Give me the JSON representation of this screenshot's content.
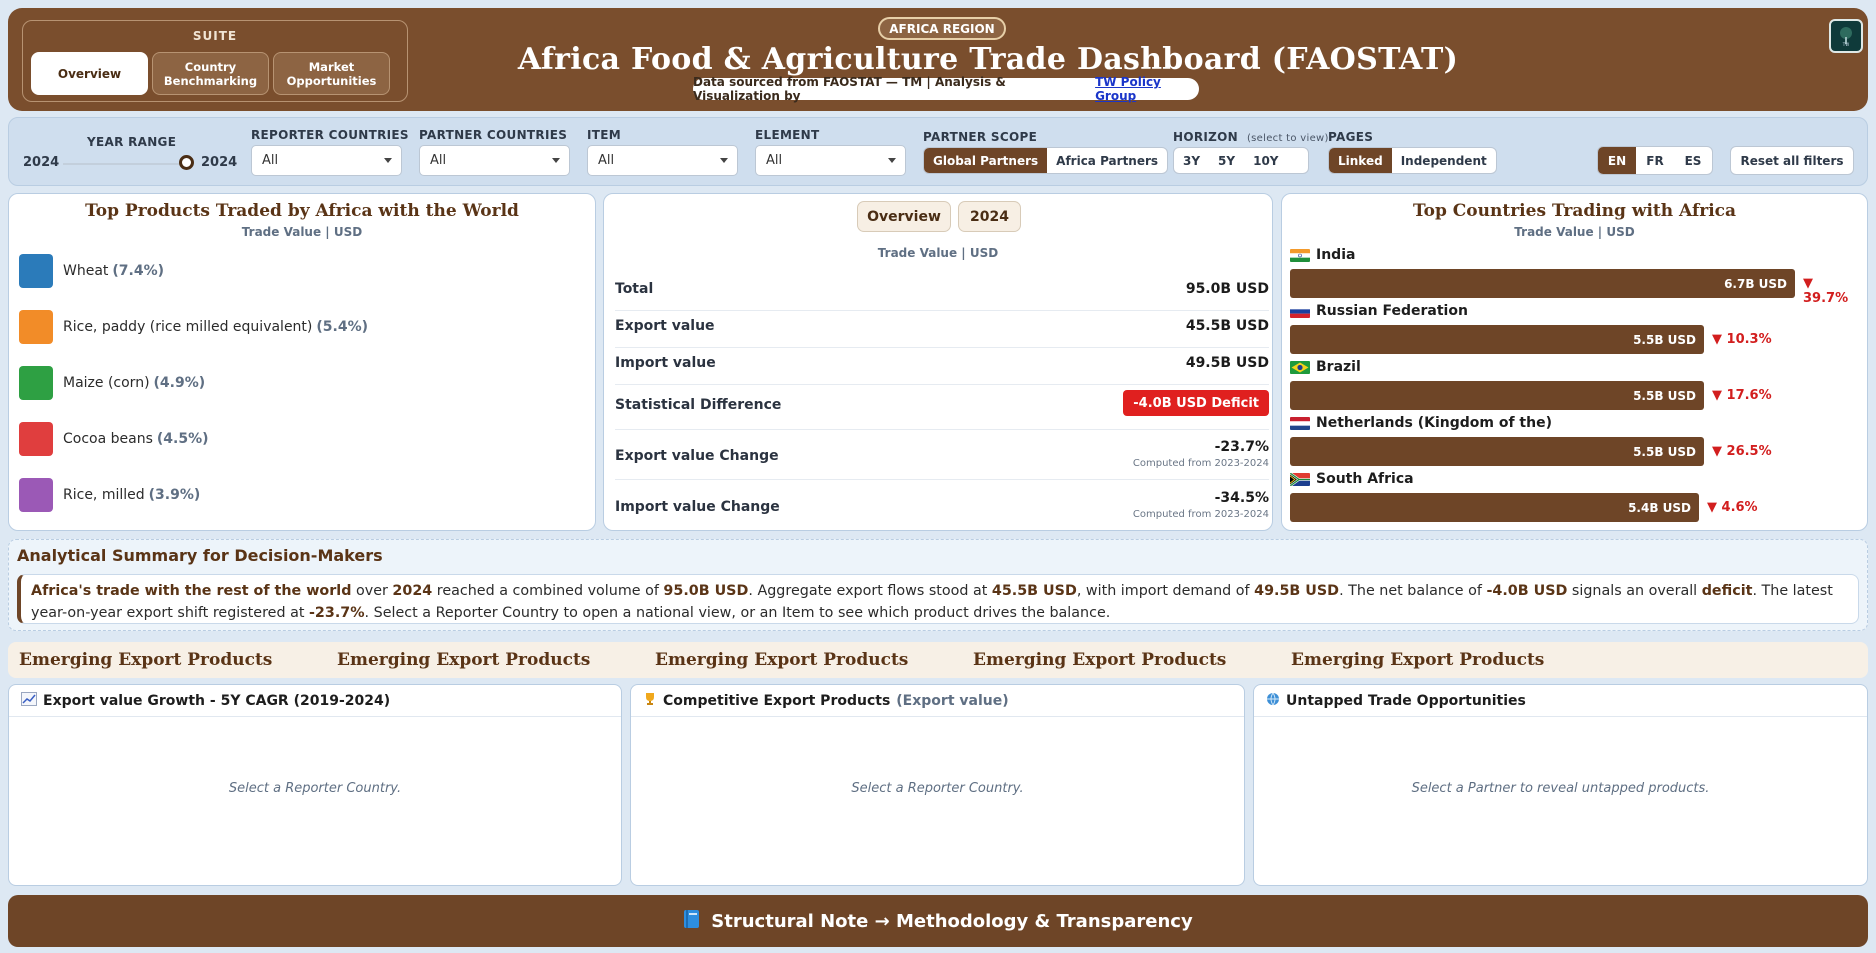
{
  "header": {
    "suite_label": "SUITE",
    "suite_tabs": [
      "Overview",
      "Country Benchmarking",
      "Market Opportunities"
    ],
    "region_badge": "AFRICA REGION",
    "title": "Africa Food & Agriculture Trade Dashboard (FAOSTAT)",
    "source_text": "Data sourced from FAOSTAT — TM | Analysis & Visualization by",
    "source_link": "TW Policy Group",
    "logo_icon": "tree-logo-icon"
  },
  "filters": {
    "year_range_label": "YEAR RANGE",
    "year_from": "2024",
    "year_to": "2024",
    "reporter_label": "REPORTER COUNTRIES",
    "reporter_value": "All",
    "partner_label": "PARTNER COUNTRIES",
    "partner_value": "All",
    "item_label": "ITEM",
    "item_value": "All",
    "element_label": "ELEMENT",
    "element_value": "All",
    "scope_label": "PARTNER SCOPE",
    "scope_options": [
      "Global Partners",
      "Africa Partners"
    ],
    "horizon_label": "HORIZON",
    "horizon_hint": "(select to view)",
    "horizon_options": [
      "3Y",
      "5Y",
      "10Y"
    ],
    "pages_label": "PAGES",
    "pages_options": [
      "Linked",
      "Independent"
    ],
    "languages": [
      "EN",
      "FR",
      "ES"
    ],
    "reset_label": "Reset all filters"
  },
  "top_products": {
    "title": "Top Products Traded by Africa with the World",
    "subtitle": "Trade Value | USD",
    "items": [
      {
        "name": "Wheat",
        "pct": "(7.4%)",
        "color": "#2b7bba"
      },
      {
        "name": "Rice, paddy (rice milled equivalent)",
        "pct": "(5.4%)",
        "color": "#f28c28"
      },
      {
        "name": "Maize (corn)",
        "pct": "(4.9%)",
        "color": "#2ea043"
      },
      {
        "name": "Cocoa beans",
        "pct": "(4.5%)",
        "color": "#e03e3e"
      },
      {
        "name": "Rice, milled",
        "pct": "(3.9%)",
        "color": "#9b59b6"
      }
    ]
  },
  "overview": {
    "tab_overview": "Overview",
    "tab_year": "2024",
    "subtitle": "Trade Value | USD",
    "rows": [
      {
        "label": "Total",
        "value": "95.0B USD"
      },
      {
        "label": "Export value",
        "value": "45.5B USD"
      },
      {
        "label": "Import value",
        "value": "49.5B USD"
      },
      {
        "label": "Statistical Difference",
        "value": "-4.0B USD Deficit"
      },
      {
        "label": "Export value Change",
        "value": "-23.7%",
        "note": "Computed from 2023-2024"
      },
      {
        "label": "Import value Change",
        "value": "-34.5%",
        "note": "Computed from 2023-2024"
      }
    ]
  },
  "top_countries": {
    "title": "Top Countries Trading with Africa",
    "subtitle": "Trade Value | USD",
    "items": [
      {
        "name": "India",
        "value": "6.7B USD",
        "change": "▼ 39.7%",
        "share": 1.0
      },
      {
        "name": "Russian Federation",
        "value": "5.5B USD",
        "change": "▼ 10.3%",
        "share": 0.82
      },
      {
        "name": "Brazil",
        "value": "5.5B USD",
        "change": "▼ 17.6%",
        "share": 0.82
      },
      {
        "name": "Netherlands (Kingdom of the)",
        "value": "5.5B USD",
        "change": "▼ 26.5%",
        "share": 0.82
      },
      {
        "name": "South Africa",
        "value": "5.4B USD",
        "change": "▼ 4.6%",
        "share": 0.81
      }
    ]
  },
  "summary": {
    "title": "Analytical Summary for Decision-Makers",
    "p1": "Africa's trade with the rest of the world",
    "p2": " over ",
    "p3": "2024",
    "p4": " reached a combined volume of ",
    "p5": "95.0B USD",
    "p6": ". Aggregate export flows stood at ",
    "p7": "45.5B USD",
    "p8": ", with import demand of ",
    "p9": "49.5B USD",
    "p10": ". The net balance of ",
    "p11": "-4.0B USD",
    "p12": " signals an overall ",
    "p13": "deficit",
    "p14": ". The latest year-on-year export shift registered at ",
    "p15": "-23.7%",
    "p16": ". Select a Reporter Country to open a national view, or an Item to see which product drives the balance."
  },
  "emerging": {
    "labels": [
      "Emerging Export Products",
      "Emerging Export Products",
      "Emerging Export Products",
      "Emerging Export Products",
      "Emerging Export Products"
    ]
  },
  "panels": {
    "growth_title": "Export value Growth - 5Y CAGR (2019-2024)",
    "growth_msg": "Select a Reporter Country.",
    "competitive_title": "Competitive Export Products",
    "competitive_sub": "(Export value)",
    "competitive_msg": "Select a Reporter Country.",
    "untapped_title": "Untapped Trade Opportunities",
    "untapped_msg": "Select a Partner to reveal untapped products."
  },
  "footer": {
    "label": "Structural Note → Methodology & Transparency"
  }
}
